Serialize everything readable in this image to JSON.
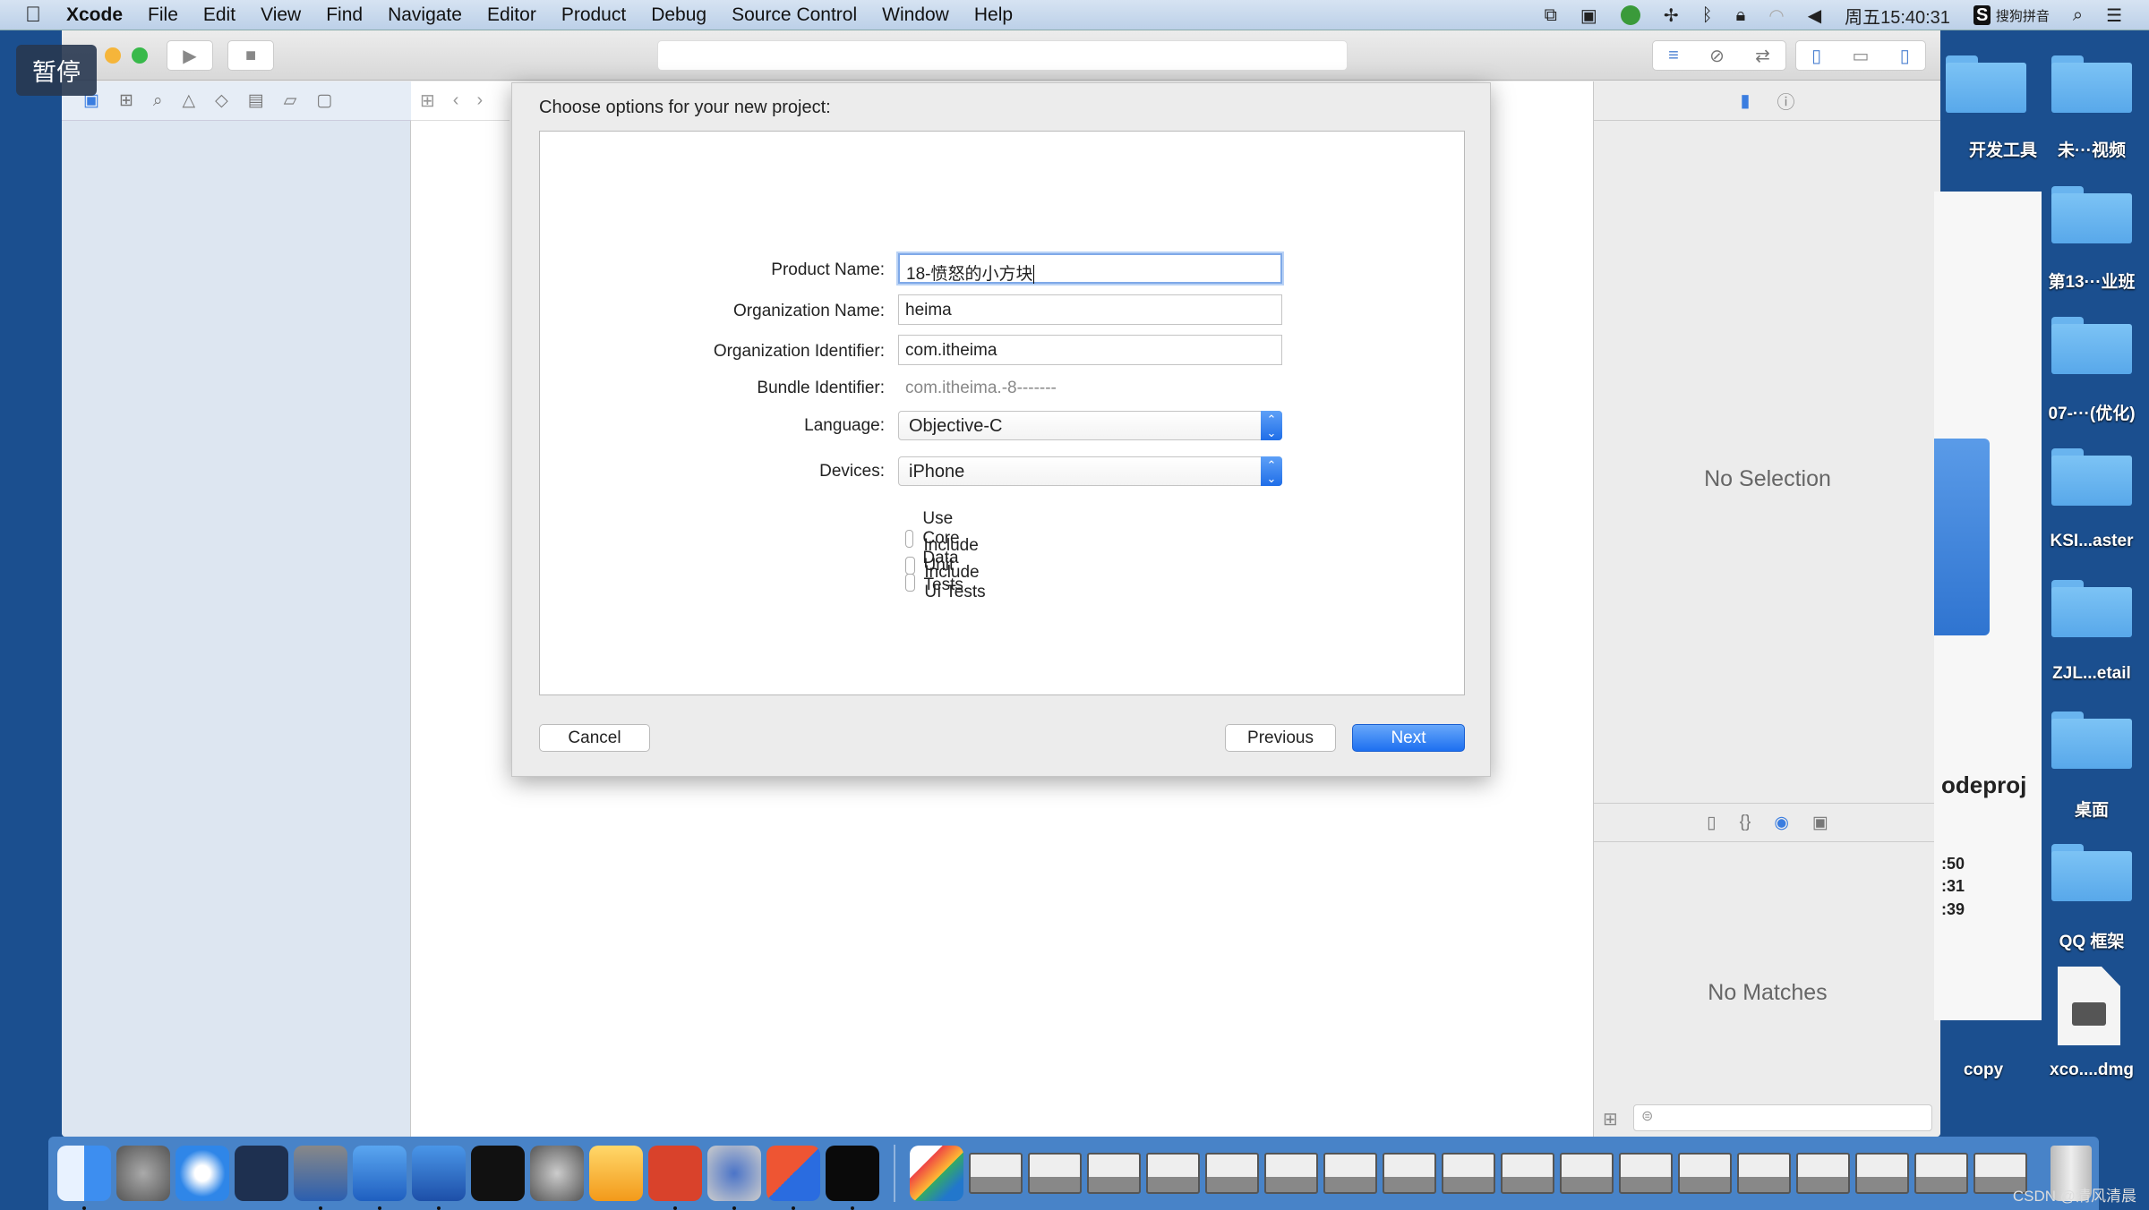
{
  "menubar": {
    "items": [
      "Xcode",
      "File",
      "Edit",
      "View",
      "Find",
      "Navigate",
      "Editor",
      "Product",
      "Debug",
      "Source Control",
      "Window",
      "Help"
    ],
    "clock": "周五15:40:31",
    "input_method": "搜狗拼音"
  },
  "overlay": {
    "pause_label": "暂停"
  },
  "dialog": {
    "title": "Choose options for your new project:",
    "product_name": {
      "label": "Product Name:",
      "value": "18-愤怒的小方块"
    },
    "organization_name": {
      "label": "Organization Name:",
      "value": "heima"
    },
    "organization_identifier": {
      "label": "Organization Identifier:",
      "value": "com.itheima"
    },
    "bundle_identifier": {
      "label": "Bundle Identifier:",
      "value": "com.itheima.-8-------"
    },
    "language": {
      "label": "Language:",
      "value": "Objective-C"
    },
    "devices": {
      "label": "Devices:",
      "value": "iPhone"
    },
    "checkboxes": [
      {
        "label": "Use Core Data",
        "checked": false
      },
      {
        "label": "Include Unit Tests",
        "checked": false
      },
      {
        "label": "Include UI Tests",
        "checked": false
      }
    ],
    "cancel": "Cancel",
    "previous": "Previous",
    "next": "Next",
    "accent": "#1d6ff0"
  },
  "inspector": {
    "no_selection": "No Selection",
    "no_matches": "No Matches"
  },
  "desktop": {
    "items": [
      "开发工具",
      "未···视频",
      "第13···业班",
      "07-···(优化)",
      "KSI...aster",
      "ZJL...etail",
      "桌面",
      "QQ 框架",
      "xco....dmg"
    ],
    "behind_window": {
      "name_fragment": "odeproj",
      "times": [
        ":50",
        ":31",
        ":39"
      ],
      "file_label": "copy"
    }
  },
  "dock": {
    "apps": [
      "finder",
      "launchpad",
      "safari",
      "mouse",
      "imovie",
      "xcode",
      "xcode-beta",
      "terminal",
      "system-preferences",
      "sketch",
      "powerpoint",
      "quicktime",
      "teamviewer",
      "activity-monitor"
    ],
    "minimized_count": 18
  },
  "watermark": "CSDN @清风清晨"
}
